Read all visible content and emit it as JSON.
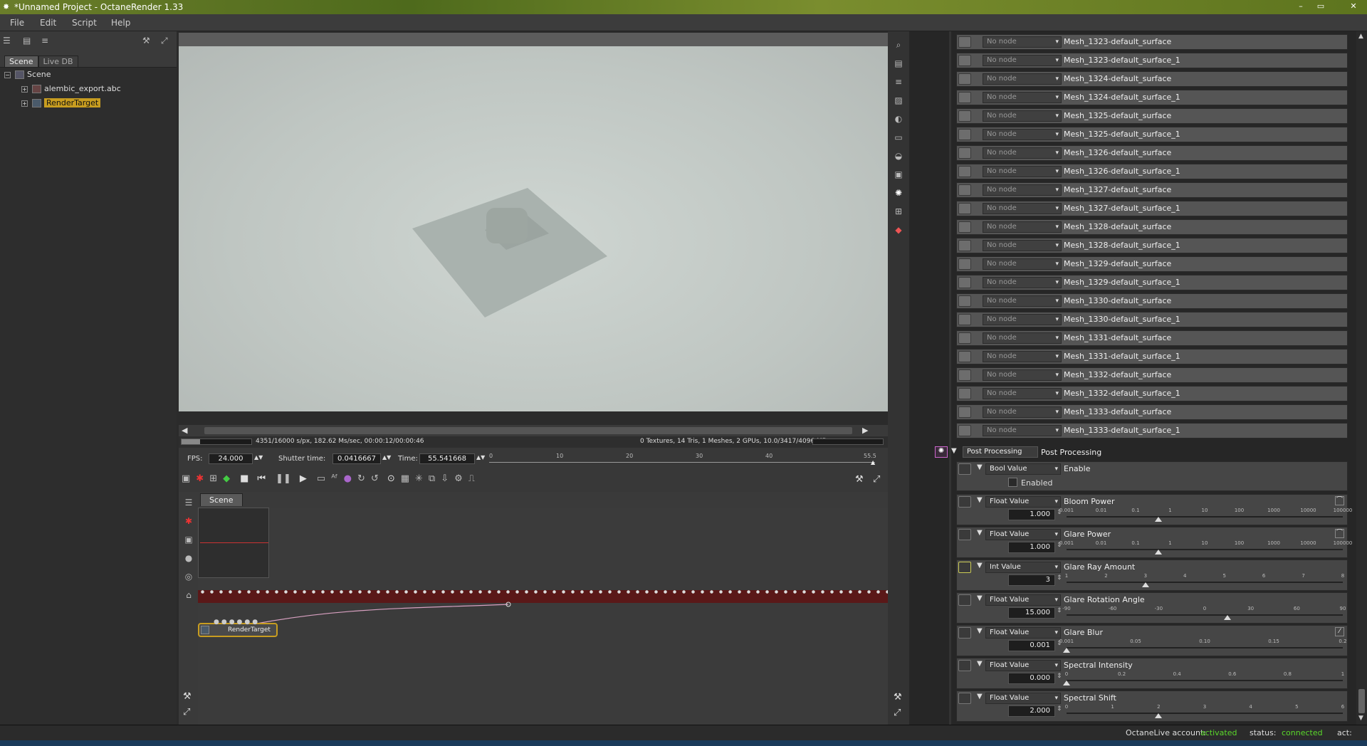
{
  "window": {
    "title": "*Unnamed Project - OctaneRender 1.33"
  },
  "menu": [
    "File",
    "Edit",
    "Script",
    "Help"
  ],
  "left_tabs": [
    {
      "label": "Scene"
    },
    {
      "label": "Live DB"
    }
  ],
  "tree": {
    "root": "Scene",
    "items": [
      {
        "label": "alembic_export.abc"
      },
      {
        "label": "RenderTarget"
      }
    ]
  },
  "stats": {
    "left": "4351/16000 s/px, 182.62 Ms/sec, 00:00:12/00:00:46",
    "right": "0 Textures, 14 Tris, 1 Meshes, 2 GPUs, 10.0/3417/4096 MB"
  },
  "controls": {
    "fps_label": "FPS:",
    "fps": "24.000",
    "shutter_label": "Shutter time:",
    "shutter": "0.0416667",
    "time_label": "Time:",
    "time": "55.541668",
    "timeline_ticks": [
      "0",
      "10",
      "20",
      "30",
      "40",
      "55.5"
    ]
  },
  "graph": {
    "tab": "Scene",
    "node": "RenderTarget"
  },
  "materials": [
    {
      "node": "No node",
      "name": "Mesh_1323-default_surface"
    },
    {
      "node": "No node",
      "name": "Mesh_1323-default_surface_1"
    },
    {
      "node": "No node",
      "name": "Mesh_1324-default_surface"
    },
    {
      "node": "No node",
      "name": "Mesh_1324-default_surface_1"
    },
    {
      "node": "No node",
      "name": "Mesh_1325-default_surface"
    },
    {
      "node": "No node",
      "name": "Mesh_1325-default_surface_1"
    },
    {
      "node": "No node",
      "name": "Mesh_1326-default_surface"
    },
    {
      "node": "No node",
      "name": "Mesh_1326-default_surface_1"
    },
    {
      "node": "No node",
      "name": "Mesh_1327-default_surface"
    },
    {
      "node": "No node",
      "name": "Mesh_1327-default_surface_1"
    },
    {
      "node": "No node",
      "name": "Mesh_1328-default_surface"
    },
    {
      "node": "No node",
      "name": "Mesh_1328-default_surface_1"
    },
    {
      "node": "No node",
      "name": "Mesh_1329-default_surface"
    },
    {
      "node": "No node",
      "name": "Mesh_1329-default_surface_1"
    },
    {
      "node": "No node",
      "name": "Mesh_1330-default_surface"
    },
    {
      "node": "No node",
      "name": "Mesh_1330-default_surface_1"
    },
    {
      "node": "No node",
      "name": "Mesh_1331-default_surface"
    },
    {
      "node": "No node",
      "name": "Mesh_1331-default_surface_1"
    },
    {
      "node": "No node",
      "name": "Mesh_1332-default_surface"
    },
    {
      "node": "No node",
      "name": "Mesh_1332-default_surface_1"
    },
    {
      "node": "No node",
      "name": "Mesh_1333-default_surface"
    },
    {
      "node": "No node",
      "name": "Mesh_1333-default_surface_1"
    }
  ],
  "post": {
    "type": "Post Processing",
    "name": "Post Processing",
    "enable": {
      "type": "Bool Value",
      "name": "Enable",
      "checkbox": "Enabled",
      "checked": false
    },
    "params": [
      {
        "type": "Float Value",
        "name": "Bloom Power",
        "value": "1.000",
        "ticks": [
          "0.001",
          "0.01",
          "0.1",
          "1",
          "10",
          "100",
          "1000",
          "10000",
          "100000"
        ],
        "pos": 0.333
      },
      {
        "type": "Float Value",
        "name": "Glare Power",
        "value": "1.000",
        "ticks": [
          "0.001",
          "0.01",
          "0.1",
          "1",
          "10",
          "100",
          "1000",
          "10000",
          "100000"
        ],
        "pos": 0.333
      },
      {
        "type": "Int Value",
        "name": "Glare Ray Amount",
        "value": "3",
        "ticks": [
          "1",
          "2",
          "3",
          "4",
          "5",
          "6",
          "7",
          "8"
        ],
        "pos": 0.286
      },
      {
        "type": "Float Value",
        "name": "Glare Rotation Angle",
        "value": "15.000",
        "ticks": [
          "-90",
          "-60",
          "-30",
          "0",
          "30",
          "60",
          "90"
        ],
        "pos": 0.583
      },
      {
        "type": "Float Value",
        "name": "Glare Blur",
        "value": "0.001",
        "ticks": [
          "0.001",
          "0.05",
          "0.10",
          "0.15",
          "0.2"
        ],
        "pos": 0.0
      },
      {
        "type": "Float Value",
        "name": "Spectral Intensity",
        "value": "0.000",
        "ticks": [
          "0",
          "0.2",
          "0.4",
          "0.6",
          "0.8",
          "1"
        ],
        "pos": 0.0
      },
      {
        "type": "Float Value",
        "name": "Spectral Shift",
        "value": "2.000",
        "ticks": [
          "0",
          "1",
          "2",
          "3",
          "4",
          "5",
          "6"
        ],
        "pos": 0.333
      }
    ]
  },
  "status": {
    "account_label": "OctaneLive account:",
    "account": "activated",
    "status_label": "status:",
    "status": "connected",
    "act": "act:"
  },
  "colors": {
    "accent": "#c89d20",
    "green": "#5ad82a",
    "titlebar": "#5d741e"
  }
}
